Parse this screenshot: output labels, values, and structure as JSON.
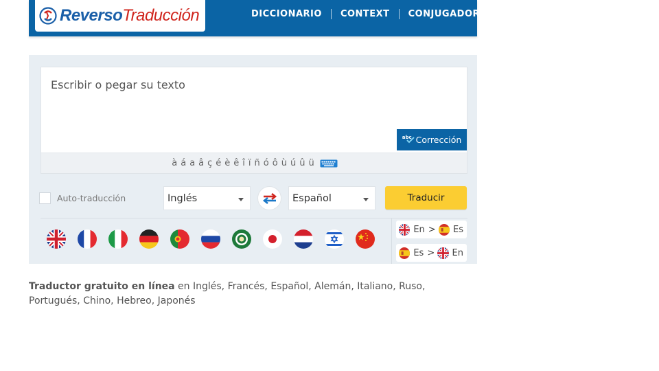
{
  "header": {
    "logo_part1": "Reverso",
    "logo_part2": "Traducción",
    "nav": [
      "DICCIONARIO",
      "CONTEXT",
      "CONJUGADOR"
    ]
  },
  "translator": {
    "input_placeholder": "Escribir o pegar su texto",
    "correction_prefix": "abc",
    "correction_label": "Corrección",
    "accent_chars": [
      "à",
      "á",
      "a",
      "â",
      "ç",
      "é",
      "è",
      "ê",
      "î",
      "ï",
      "ñ",
      "ó",
      "ô",
      "ù",
      "ú",
      "û",
      "ü"
    ],
    "auto_translate_label": "Auto-traducción",
    "source_language": "Inglés",
    "target_language": "Español",
    "translate_button": "Traducir",
    "flags": [
      "uk",
      "france",
      "italy",
      "germany",
      "portugal",
      "russia",
      "arabic",
      "japan",
      "netherlands",
      "israel",
      "china"
    ],
    "pairs": [
      {
        "from": "En",
        "to": "Es",
        "from_flag": "uk",
        "to_flag": "spain"
      },
      {
        "from": "Es",
        "to": "En",
        "from_flag": "spain",
        "to_flag": "uk"
      }
    ],
    "pair_separator": ">"
  },
  "footer": {
    "strong": "Traductor gratuito en línea",
    "rest": " en Inglés, Francés, Español, Alemán, Italiano, Ruso, Portugués, Chino, Hebreo, Japonés"
  },
  "colors": {
    "brand_blue": "#0b64a5",
    "logo_red": "#d0261e",
    "translate_yellow": "#fbcd32",
    "panel_bg": "#e8eef3"
  }
}
